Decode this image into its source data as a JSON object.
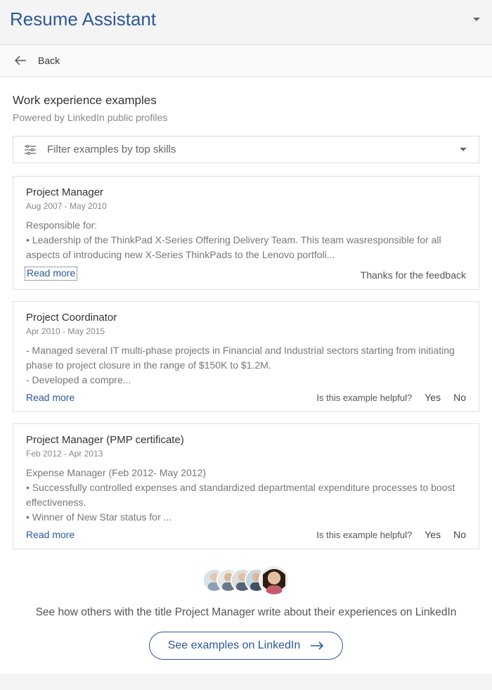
{
  "pane": {
    "title": "Resume Assistant"
  },
  "back": {
    "label": "Back"
  },
  "section": {
    "title": "Work experience examples",
    "subtitle": "Powered by LinkedIn public profiles"
  },
  "filter": {
    "placeholder": "Filter examples by top skills"
  },
  "feedback": {
    "thanks": "Thanks for the feedback",
    "prompt": "Is this example helpful?",
    "yes": "Yes",
    "no": "No",
    "read_more": "Read more"
  },
  "cards": [
    {
      "title": "Project Manager",
      "date_range": "Aug 2007 - May 2010",
      "body": "Responsible for:\n• Leadership of the ThinkPad X-Series Offering Delivery Team. This team wasresponsible for all aspects of introducing new X-Series ThinkPads to the Lenovo portfoli...",
      "feedback_state": "thanks"
    },
    {
      "title": "Project Coordinator",
      "date_range": "Apr 2010 - May 2015",
      "body": "- Managed several IT multi-phase projects in Financial and Industrial sectors starting from initiating phase to project closure in the range of $150K to $1.2M.\n- Developed a compre...",
      "feedback_state": "prompt"
    },
    {
      "title": "Project Manager (PMP certificate)",
      "date_range": "Feb 2012 - Apr 2013",
      "body": "Expense Manager (Feb 2012- May 2012)\n• Successfully controlled expenses and standardized departmental expenditure processes to boost effectiveness.\n• Winner of New Star status for ...",
      "feedback_state": "prompt"
    }
  ],
  "footer": {
    "see_how": "See how others with the title Project Manager write about their experiences on LinkedIn",
    "cta": "See examples on LinkedIn"
  }
}
